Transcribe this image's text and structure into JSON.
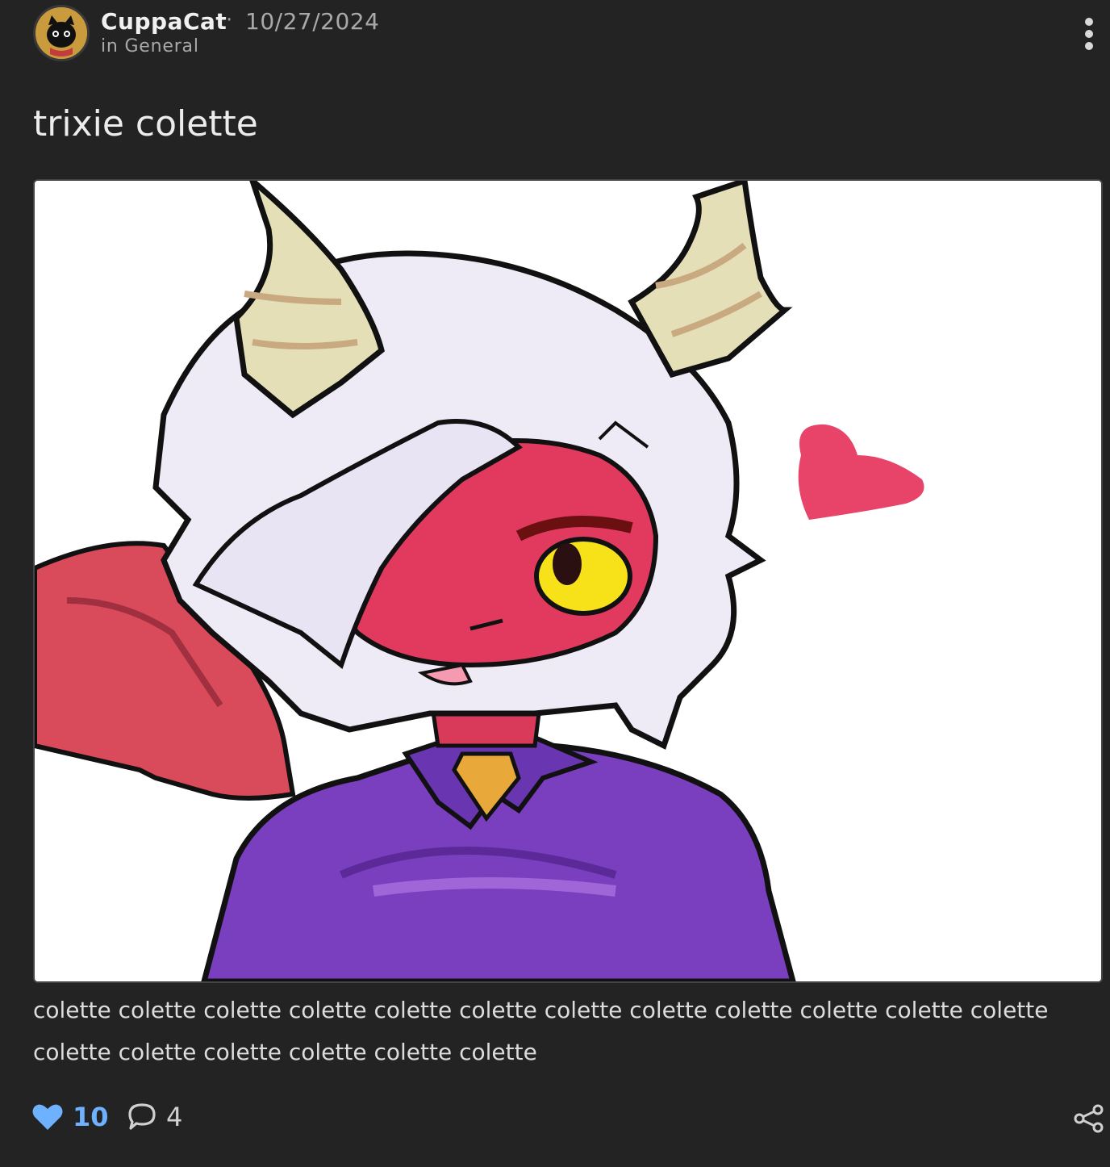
{
  "post": {
    "author": "CuppaCat",
    "separator": "·",
    "date": "10/27/2024",
    "channel": "in General",
    "title": "trixie colette",
    "body": "colette colette colette colette colette colette colette colette colette colette colette colette colette colette colette colette colette colette",
    "likes": "10",
    "comments": "4"
  },
  "colors": {
    "background": "#232323",
    "like_accent": "#6db1ff",
    "text": "#e6e6e6"
  },
  "icons": {
    "avatar": "black-cat-avatar",
    "more": "more-vertical-icon",
    "like": "heart-icon",
    "comment": "comment-bubble-icon",
    "share": "share-icon"
  }
}
